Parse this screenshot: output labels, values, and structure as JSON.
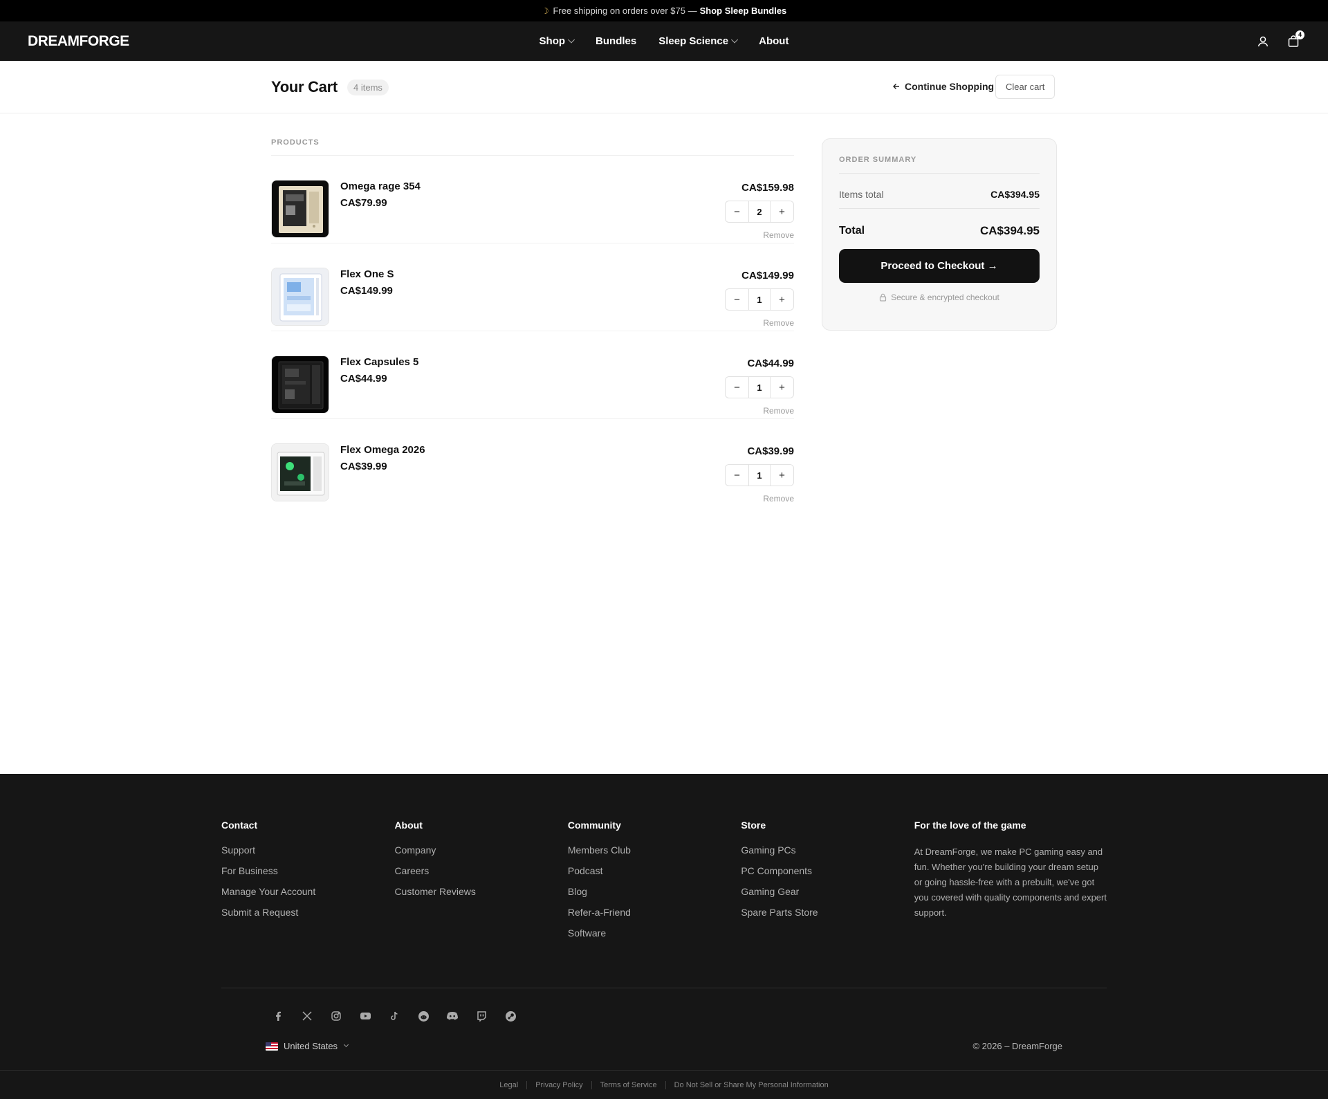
{
  "announcement": {
    "text": "Free shipping on orders over $75 —",
    "link": "Shop Sleep Bundles"
  },
  "header": {
    "logo": "DREAMFORGE",
    "nav": [
      {
        "label": "Shop",
        "has_dropdown": true
      },
      {
        "label": "Bundles",
        "has_dropdown": false
      },
      {
        "label": "Sleep Science",
        "has_dropdown": true
      },
      {
        "label": "About",
        "has_dropdown": false
      }
    ],
    "cart_count": "4"
  },
  "cart": {
    "title": "Your Cart",
    "count_label": "4 items",
    "continue_label": "Continue Shopping",
    "clear_label": "Clear cart",
    "section_label": "PRODUCTS",
    "items": [
      {
        "name": "Omega rage 354",
        "unit_price": "CA$79.99",
        "line_total": "CA$159.98",
        "qty": "2",
        "remove": "Remove",
        "case": "beige"
      },
      {
        "name": "Flex One S",
        "unit_price": "CA$149.99",
        "line_total": "CA$149.99",
        "qty": "1",
        "remove": "Remove",
        "case": "white-blue"
      },
      {
        "name": "Flex Capsules 5",
        "unit_price": "CA$44.99",
        "line_total": "CA$44.99",
        "qty": "1",
        "remove": "Remove",
        "case": "black"
      },
      {
        "name": "Flex Omega 2026",
        "unit_price": "CA$39.99",
        "line_total": "CA$39.99",
        "qty": "1",
        "remove": "Remove",
        "case": "white-green"
      }
    ]
  },
  "summary": {
    "label": "ORDER SUMMARY",
    "items_total_label": "Items total",
    "items_total": "CA$394.95",
    "total_label": "Total",
    "total": "CA$394.95",
    "checkout_label": "Proceed to Checkout →",
    "secure_label": "Secure & encrypted checkout"
  },
  "footer": {
    "columns": [
      {
        "title": "Contact",
        "links": [
          "Support",
          "For Business",
          "Manage Your Account",
          "Submit a Request"
        ]
      },
      {
        "title": "About",
        "links": [
          "Company",
          "Careers",
          "Customer Reviews"
        ]
      },
      {
        "title": "Community",
        "links": [
          "Members Club",
          "Podcast",
          "Blog",
          "Refer-a-Friend",
          "Software"
        ]
      },
      {
        "title": "Store",
        "links": [
          "Gaming PCs",
          "PC Components",
          "Gaming Gear",
          "Spare Parts Store"
        ]
      }
    ],
    "about": {
      "title": "For the love of the game",
      "text": "At DreamForge, we make PC gaming easy and fun. Whether you're building your dream setup or going hassle-free with a prebuilt, we've got you covered with quality components and expert support."
    },
    "socials": [
      "facebook-icon",
      "x-icon",
      "instagram-icon",
      "youtube-icon",
      "tiktok-icon",
      "reddit-icon",
      "discord-icon",
      "twitch-icon",
      "steam-icon"
    ],
    "region": "United States",
    "copyright": "© 2026 – DreamForge",
    "legal": [
      "Legal",
      "Privacy Policy",
      "Terms of Service",
      "Do Not Sell or Share My Personal Information"
    ]
  },
  "colors": {
    "dark": "#161616",
    "announce": "#000000",
    "accent": "#121212"
  }
}
